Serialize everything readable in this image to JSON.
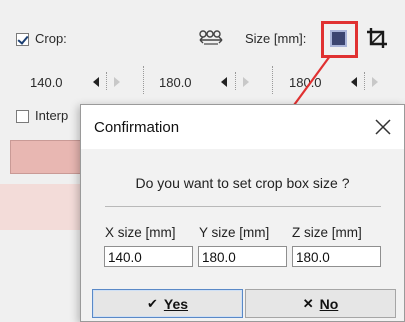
{
  "panel": {
    "crop_label": "Crop:",
    "crop_checked": true,
    "size_label": "Size [mm]:",
    "interp_label": "Interp",
    "interp_checked": false,
    "x_value": "140.0",
    "y_value": "180.0",
    "z_value": "180.0",
    "icons": {
      "linked_resize": "chain-resize-icon",
      "set_box_size": "set-crop-size-icon",
      "crop_tool": "crop-icon"
    }
  },
  "dialog": {
    "title": "Confirmation",
    "message": "Do you want to set crop box size ?",
    "x_label": "X size [mm]",
    "y_label": "Y size [mm]",
    "z_label": "Z size [mm]",
    "x_value": "140.0",
    "y_value": "180.0",
    "z_value": "180.0",
    "yes_label": "Yes",
    "no_label": "No"
  },
  "colors": {
    "highlight": "#e03131",
    "pink_bar": "#e8b7b2"
  }
}
